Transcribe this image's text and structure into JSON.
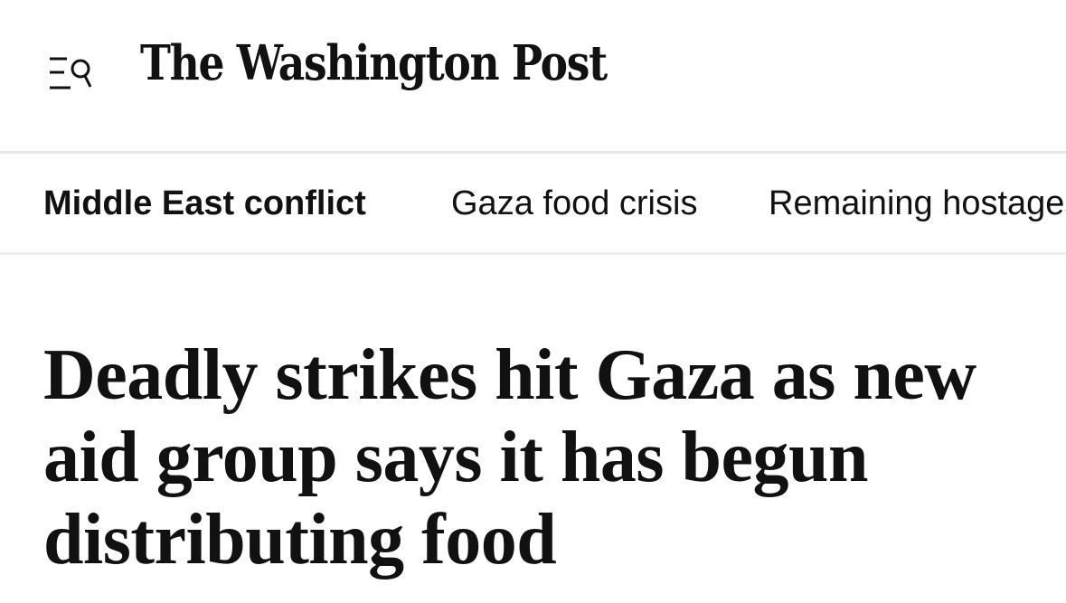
{
  "header": {
    "menu_icon": "menu-search-icon",
    "logo_text": "The Washington Post"
  },
  "topic_nav": {
    "items": [
      {
        "label": "Middle East conflict",
        "active": true
      },
      {
        "label": "Gaza food crisis",
        "active": false
      },
      {
        "label": "Remaining hostages",
        "active": false
      }
    ]
  },
  "article": {
    "headline": "Deadly strikes hit Gaza as new aid group says it has begun distributing food"
  },
  "colors": {
    "text": "#111111",
    "divider": "#e8e8e8",
    "background": "#ffffff"
  }
}
